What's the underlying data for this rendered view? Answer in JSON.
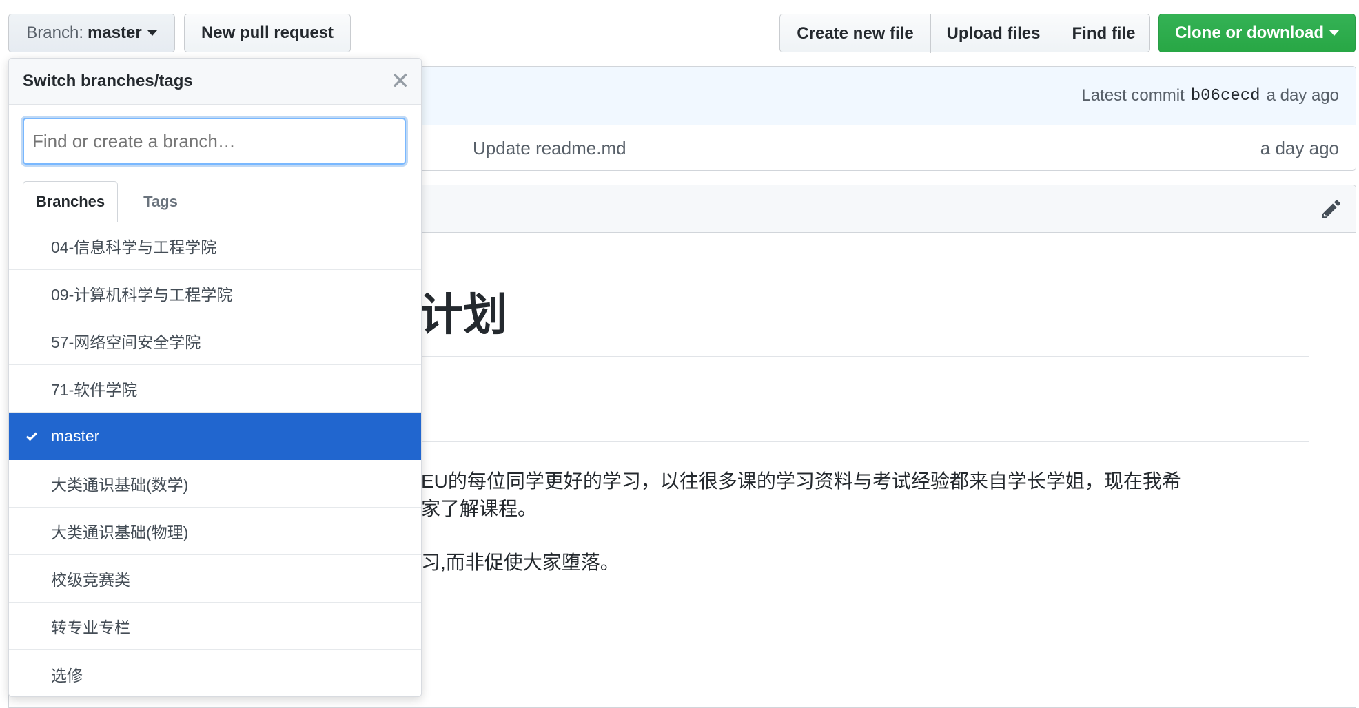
{
  "toolbar": {
    "branch_prefix": "Branch:",
    "branch_name": "master",
    "new_pull_request": "New pull request",
    "create_new_file": "Create new file",
    "upload_files": "Upload files",
    "find_file": "Find file",
    "clone_or_download": "Clone or download"
  },
  "commit": {
    "latest_label": "Latest commit",
    "hash": "b06cecd",
    "time": "a day ago"
  },
  "file_row": {
    "message": "Update readme.md",
    "time": "a day ago"
  },
  "readme": {
    "heading_visible": "计划",
    "para1_line1": "EU的每位同学更好的学习，以往很多课的学习资料与考试经验都来自学长学姐，现在我希",
    "para1_line2": "家了解课程。",
    "para2": "习,而非促使大家堕落。"
  },
  "dropdown": {
    "title": "Switch branches/tags",
    "search_placeholder": "Find or create a branch…",
    "tab_branches": "Branches",
    "tab_tags": "Tags",
    "items": [
      "04-信息科学与工程学院",
      "09-计算机科学与工程学院",
      "57-网络空间安全学院",
      "71-软件学院",
      "master",
      "大类通识基础(数学)",
      "大类通识基础(物理)",
      "校级竞赛类",
      "转专业专栏",
      "选修"
    ],
    "selected": "master"
  },
  "colors": {
    "accent_blue": "#2166cf",
    "clone_green": "#2ea44f",
    "commit_bar_bg": "#f1f8ff"
  }
}
